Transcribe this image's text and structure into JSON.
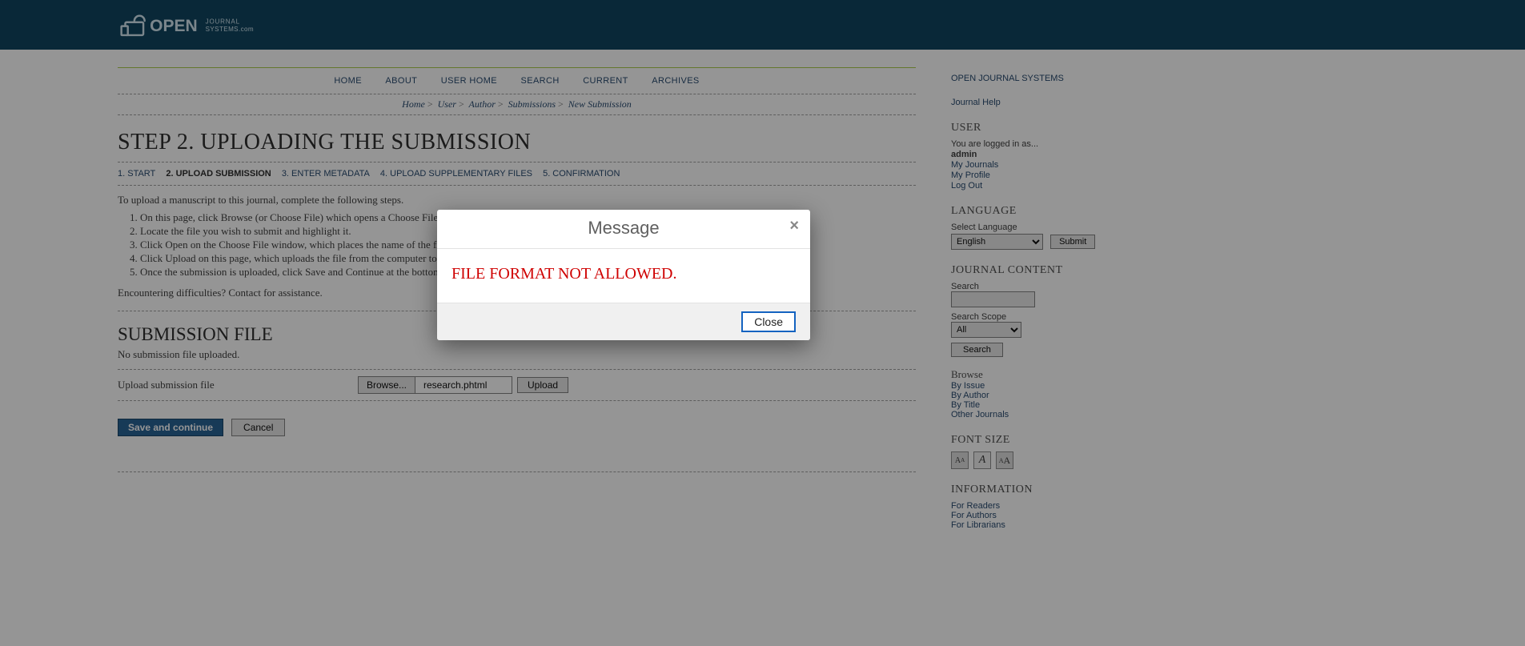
{
  "brand": {
    "line1": "OPEN",
    "line2a": "JOURNAL",
    "line2b": "SYSTEMS.com"
  },
  "nav": [
    "HOME",
    "ABOUT",
    "USER HOME",
    "SEARCH",
    "CURRENT",
    "ARCHIVES"
  ],
  "breadcrumbs": {
    "items": [
      "Home",
      "User",
      "Author",
      "Submissions"
    ],
    "current": "New Submission"
  },
  "page": {
    "title": "STEP 2. UPLOADING THE SUBMISSION",
    "steps": [
      {
        "label": "1. START",
        "active": false
      },
      {
        "label": "2. UPLOAD SUBMISSION",
        "active": true
      },
      {
        "label": "3. ENTER METADATA",
        "active": false
      },
      {
        "label": "4. UPLOAD SUPPLEMENTARY FILES",
        "active": false
      },
      {
        "label": "5. CONFIRMATION",
        "active": false
      }
    ],
    "intro": "To upload a manuscript to this journal, complete the following steps.",
    "instructions": [
      "On this page, click Browse (or Choose File) which opens a Choose File window for locating the file on the hard drive of your computer.",
      "Locate the file you wish to submit and highlight it.",
      "Click Open on the Choose File window, which places the name of the file on this page.",
      "Click Upload on this page, which uploads the file from the computer to the journal's web site and renames it following the journal's conventions.",
      "Once the submission is uploaded, click Save and Continue at the bottom of this page."
    ],
    "difficulty": "Encountering difficulties? Contact for assistance.",
    "submission_file_heading": "SUBMISSION FILE",
    "no_file_text": "No submission file uploaded.",
    "upload_label": "Upload submission file",
    "browse_label": "Browse...",
    "filename": "research.phtml",
    "upload_btn": "Upload",
    "save_btn": "Save and continue",
    "cancel_btn": "Cancel"
  },
  "sidebar": {
    "ojs_link": "OPEN JOURNAL SYSTEMS",
    "help_link": "Journal Help",
    "user_heading": "USER",
    "logged_in_prefix": "You are logged in as...",
    "username": "admin",
    "user_links": [
      "My Journals",
      "My Profile",
      "Log Out"
    ],
    "language_heading": "LANGUAGE",
    "language_label": "Select Language",
    "language_value": "English",
    "submit_btn": "Submit",
    "content_heading": "JOURNAL CONTENT",
    "search_label": "Search",
    "scope_label": "Search Scope",
    "scope_value": "All",
    "search_btn": "Search",
    "browse_heading": "Browse",
    "browse_links": [
      "By Issue",
      "By Author",
      "By Title",
      "Other Journals"
    ],
    "fontsize_heading": "FONT SIZE",
    "info_heading": "INFORMATION",
    "info_links": [
      "For Readers",
      "For Authors",
      "For Librarians"
    ]
  },
  "modal": {
    "title": "Message",
    "body": "FILE FORMAT NOT ALLOWED.",
    "close": "Close"
  }
}
